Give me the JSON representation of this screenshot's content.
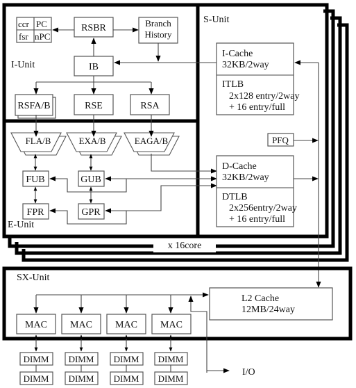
{
  "diagram": {
    "core_count_label": "x 16core",
    "i_unit": {
      "label": "I-Unit",
      "registers": {
        "ccr": "ccr",
        "pc": "PC",
        "fsr": "fsr",
        "npc": "nPC"
      },
      "rsbr": "RSBR",
      "branch_history": [
        "Branch",
        "History"
      ],
      "ib": "IB",
      "rsfa": "RSFA/B",
      "rse": "RSE",
      "rsa": "RSA"
    },
    "e_unit": {
      "label": "E-Unit",
      "fla": "FLA/B",
      "exa": "EXA/B",
      "eaga": "EAGA/B",
      "fub": "FUB",
      "gub": "GUB",
      "fpr": "FPR",
      "gpr": "GPR"
    },
    "s_unit": {
      "label": "S-Unit",
      "icache": [
        "I-Cache",
        "32KB/2way"
      ],
      "itlb": [
        "ITLB",
        "2x128 entry/2way",
        "+ 16 entry/full"
      ],
      "pfq": "PFQ",
      "dcache": [
        "D-Cache",
        "32KB/2way"
      ],
      "dtlb": [
        "DTLB",
        "2x256entry/2way",
        "+ 16 entry/full"
      ]
    },
    "sx_unit": {
      "label": "SX-Unit",
      "l2": [
        "L2 Cache",
        "12MB/24way"
      ],
      "macs": [
        "MAC",
        "MAC",
        "MAC",
        "MAC"
      ],
      "dimm_label": "DIMM",
      "io": "I/O"
    }
  }
}
